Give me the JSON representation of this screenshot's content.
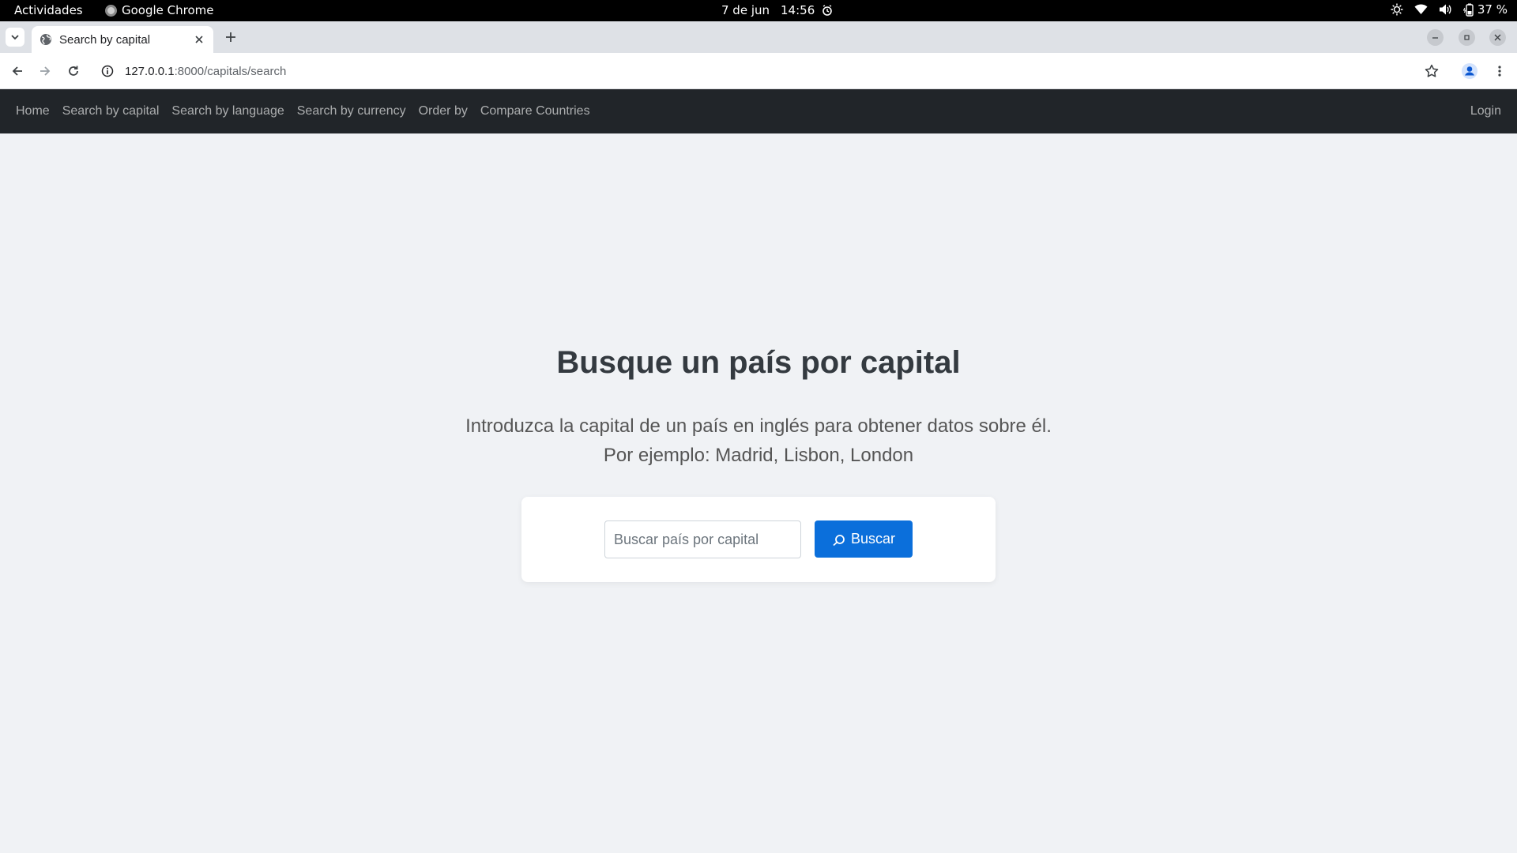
{
  "system_bar": {
    "activities": "Actividades",
    "app_name": "Google Chrome",
    "date": "7 de jun",
    "time": "14:56",
    "battery": "37 %"
  },
  "browser": {
    "tab_title": "Search by capital",
    "url_host": "127.0.0.1",
    "url_path": ":8000/capitals/search"
  },
  "navbar": {
    "links": [
      "Home",
      "Search by capital",
      "Search by language",
      "Search by currency",
      "Order by",
      "Compare Countries"
    ],
    "login": "Login"
  },
  "main": {
    "title": "Busque un país por capital",
    "description_line1": "Introduzca la capital de un país en inglés para obtener datos sobre él.",
    "description_line2": "Por ejemplo: Madrid, Lisbon, London",
    "search_placeholder": "Buscar país por capital",
    "search_value": "",
    "search_button": "Buscar"
  },
  "colors": {
    "navbar_bg": "#212529",
    "page_bg": "#f0f2f5",
    "primary_button": "#0b6fdb"
  }
}
